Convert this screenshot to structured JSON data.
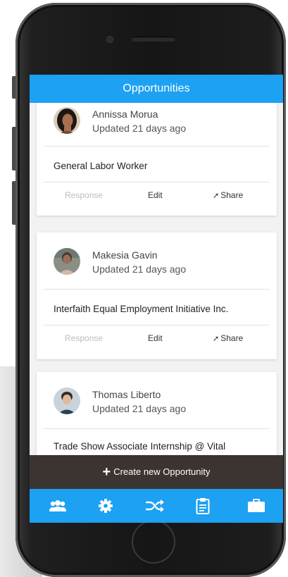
{
  "header": {
    "title": "Opportunities"
  },
  "cards": [
    {
      "author": "Annissa Morua",
      "updated": "Updated 21 days ago",
      "title": "General Labor Worker",
      "actions": {
        "response": "Response",
        "edit": "Edit",
        "share": "Share"
      }
    },
    {
      "author": "Makesia Gavin",
      "updated": "Updated 21 days ago",
      "title": "Interfaith Equal Employment Initiative Inc.",
      "actions": {
        "response": "Response",
        "edit": "Edit",
        "share": "Share"
      }
    },
    {
      "author": "Thomas Liberto",
      "updated": "Updated 21 days ago",
      "title": "Trade Show Associate Internship @ Vital"
    }
  ],
  "create_button": {
    "label": "Create new Opportunity"
  },
  "tabs": [
    {
      "icon": "people-icon"
    },
    {
      "icon": "gear-icon"
    },
    {
      "icon": "shuffle-icon"
    },
    {
      "icon": "clipboard-icon"
    },
    {
      "icon": "briefcase-icon"
    }
  ],
  "colors": {
    "accent": "#1da1f2",
    "create_bar": "#3b3430",
    "phone": "#1a1a1a"
  }
}
